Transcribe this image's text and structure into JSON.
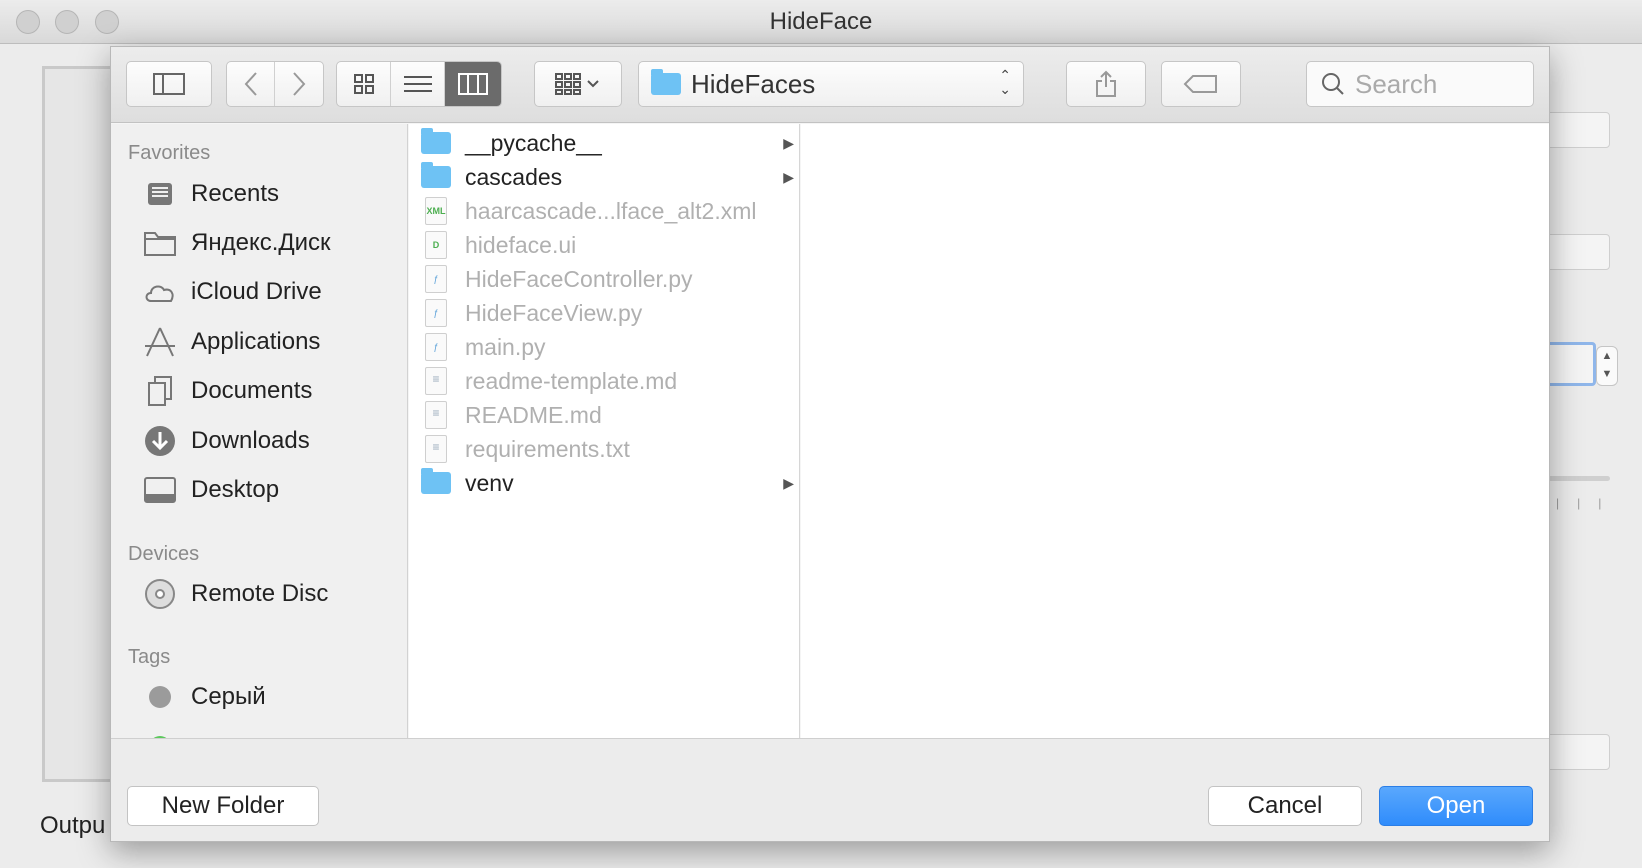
{
  "window": {
    "title": "HideFace"
  },
  "background": {
    "output_label": "Outpu"
  },
  "dialog": {
    "toolbar": {
      "sidebar_toggle_icon": "sidebar-icon",
      "back_icon": "chevron-left-icon",
      "forward_icon": "chevron-right-icon",
      "view_modes": [
        "icon-view",
        "list-view",
        "column-view"
      ],
      "active_view": "column-view",
      "arrange_icon": "arrange-grid-icon",
      "path": "HideFaces",
      "share_icon": "share-icon",
      "tag_icon": "tag-icon",
      "search_placeholder": "Search"
    },
    "sidebar": {
      "favorites_header": "Favorites",
      "favorites": [
        {
          "label": "Recents",
          "icon": "recents-icon"
        },
        {
          "label": "Яндекс.Диск",
          "icon": "folder-icon"
        },
        {
          "label": "iCloud Drive",
          "icon": "cloud-icon"
        },
        {
          "label": "Applications",
          "icon": "applications-icon"
        },
        {
          "label": "Documents",
          "icon": "documents-icon"
        },
        {
          "label": "Downloads",
          "icon": "downloads-icon"
        },
        {
          "label": "Desktop",
          "icon": "desktop-icon"
        }
      ],
      "devices_header": "Devices",
      "devices": [
        {
          "label": "Remote Disc",
          "icon": "disc-icon"
        }
      ],
      "tags_header": "Tags",
      "tags": [
        {
          "label": "Серый",
          "color": "#9b9b9b"
        }
      ]
    },
    "files": [
      {
        "name": "__pycache__",
        "type": "folder",
        "enabled": true
      },
      {
        "name": "cascades",
        "type": "folder",
        "enabled": true
      },
      {
        "name": "haarcascade...lface_alt2.xml",
        "type": "xml",
        "enabled": false
      },
      {
        "name": "hideface.ui",
        "type": "ui",
        "enabled": false
      },
      {
        "name": "HideFaceController.py",
        "type": "py",
        "enabled": false
      },
      {
        "name": "HideFaceView.py",
        "type": "py",
        "enabled": false
      },
      {
        "name": "main.py",
        "type": "py",
        "enabled": false
      },
      {
        "name": "readme-template.md",
        "type": "md",
        "enabled": false
      },
      {
        "name": "README.md",
        "type": "md",
        "enabled": false
      },
      {
        "name": "requirements.txt",
        "type": "txt",
        "enabled": false
      },
      {
        "name": "venv",
        "type": "folder",
        "enabled": true
      }
    ],
    "footer": {
      "new_folder_label": "New Folder",
      "cancel_label": "Cancel",
      "open_label": "Open"
    },
    "colors": {
      "accent": "#2f8cfb",
      "folder": "#6ec2f4"
    }
  }
}
